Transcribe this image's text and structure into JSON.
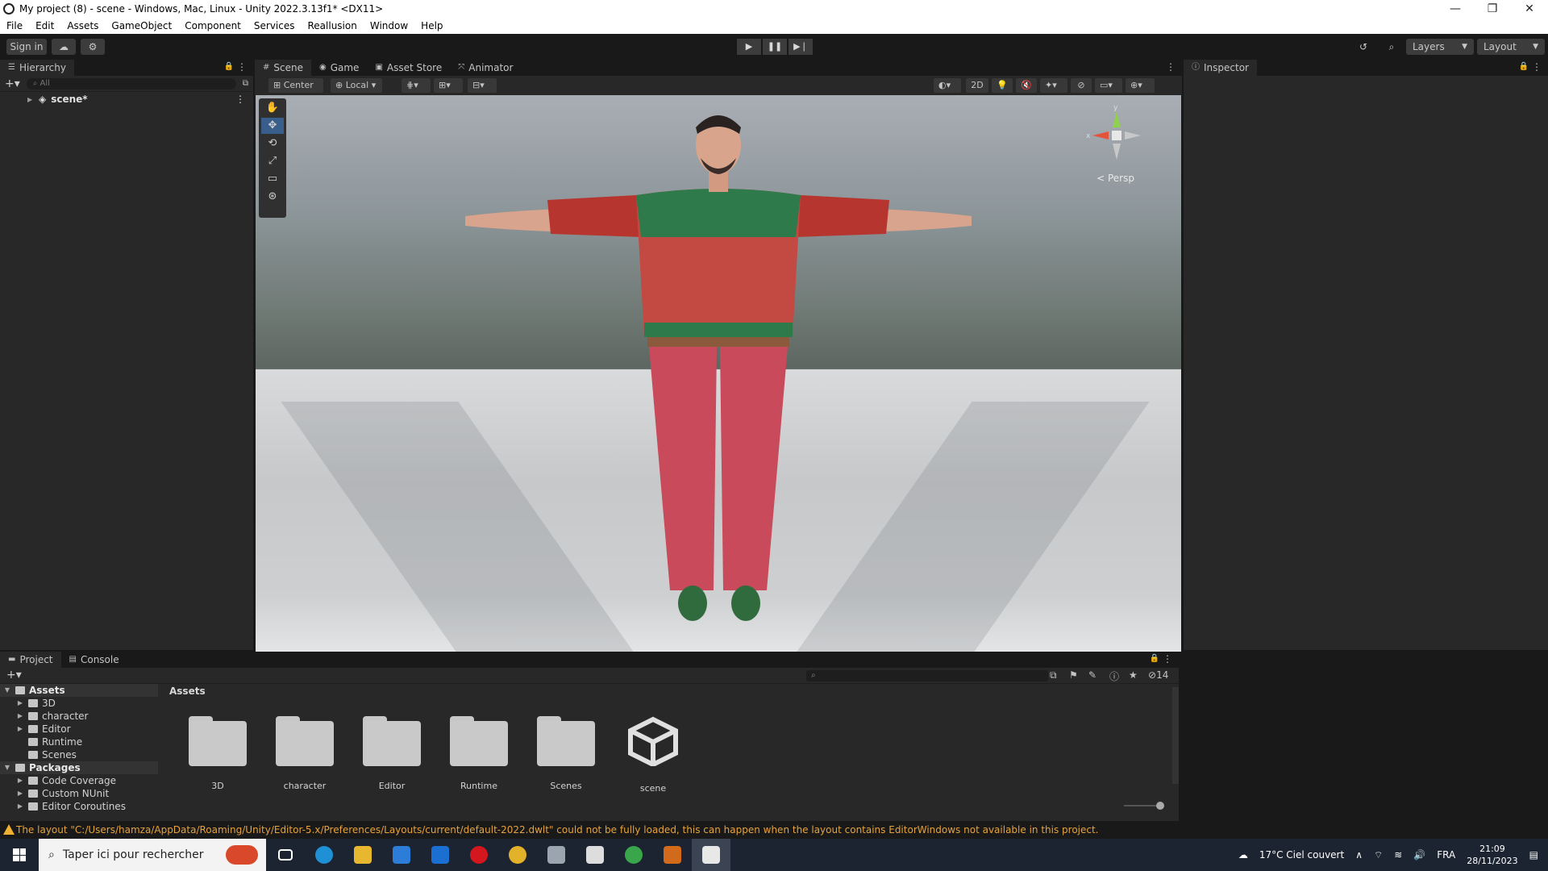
{
  "window": {
    "title": "My project (8) - scene - Windows, Mac, Linux - Unity 2022.3.13f1* <DX11>",
    "controls": [
      "—",
      "❐",
      "✕"
    ]
  },
  "menu": [
    "File",
    "Edit",
    "Assets",
    "GameObject",
    "Component",
    "Services",
    "Reallusion",
    "Window",
    "Help"
  ],
  "toolbar": {
    "sign_in": "Sign in",
    "layers": "Layers",
    "layout": "Layout"
  },
  "hierarchy": {
    "tab": "Hierarchy",
    "search_placeholder": "All",
    "scene_item": "scene*"
  },
  "scene_tabs": [
    "Scene",
    "Game",
    "Asset Store",
    "Animator"
  ],
  "scene_toolbar": {
    "pivot": "Center",
    "space": "Local",
    "mode_2d": "2D",
    "persp": "< Persp",
    "gizmo_y": "y",
    "gizmo_x": "x"
  },
  "inspector": {
    "tab": "Inspector"
  },
  "project": {
    "tabs": [
      "Project",
      "Console"
    ],
    "breadcrumb": "Assets",
    "hidden_count": "14",
    "tree": [
      {
        "label": "Assets",
        "header": true,
        "indent": 0
      },
      {
        "label": "3D",
        "indent": 1,
        "arrow": true
      },
      {
        "label": "character",
        "indent": 1,
        "arrow": true
      },
      {
        "label": "Editor",
        "indent": 1,
        "arrow": true
      },
      {
        "label": "Runtime",
        "indent": 1,
        "arrow": false
      },
      {
        "label": "Scenes",
        "indent": 1,
        "arrow": false
      },
      {
        "label": "Packages",
        "header": true,
        "indent": 0
      },
      {
        "label": "Code Coverage",
        "indent": 1,
        "arrow": true
      },
      {
        "label": "Custom NUnit",
        "indent": 1,
        "arrow": true
      },
      {
        "label": "Editor Coroutines",
        "indent": 1,
        "arrow": true
      }
    ],
    "assets": [
      "3D",
      "character",
      "Editor",
      "Runtime",
      "Scenes",
      "scene"
    ]
  },
  "status": {
    "message": "The layout \"C:/Users/hamza/AppData/Roaming/Unity/Editor-5.x/Preferences/Layouts/current/default-2022.dwlt\" could not be fully loaded, this can happen when the layout contains EditorWindows not available in this project."
  },
  "taskbar": {
    "search": "Taper ici pour rechercher",
    "weather": "17°C  Ciel couvert",
    "lang": "FRA",
    "time": "21:09",
    "date": "28/11/2023"
  }
}
